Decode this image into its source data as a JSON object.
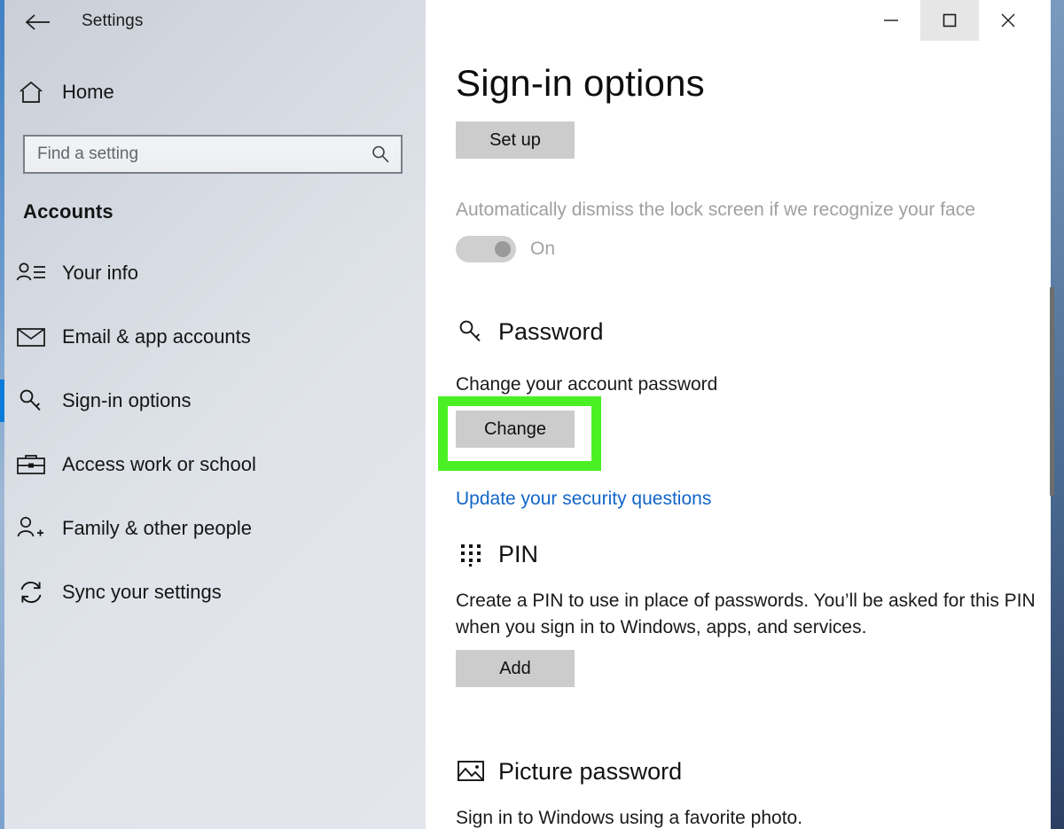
{
  "window": {
    "app_title": "Settings",
    "back_icon": "back-arrow-icon",
    "controls": {
      "minimize": "minimize-icon",
      "maximize": "maximize-icon",
      "close": "close-icon"
    }
  },
  "sidebar": {
    "home": {
      "label": "Home",
      "icon": "home-icon"
    },
    "search": {
      "placeholder": "Find a setting",
      "value": "",
      "icon": "search-icon"
    },
    "section_title": "Accounts",
    "items": [
      {
        "label": "Your info",
        "icon": "user-info-icon",
        "selected": false
      },
      {
        "label": "Email & app accounts",
        "icon": "envelope-icon",
        "selected": false
      },
      {
        "label": "Sign-in options",
        "icon": "key-icon",
        "selected": true
      },
      {
        "label": "Access work or school",
        "icon": "briefcase-icon",
        "selected": false
      },
      {
        "label": "Family & other people",
        "icon": "user-add-icon",
        "selected": false
      },
      {
        "label": "Sync your settings",
        "icon": "sync-icon",
        "selected": false
      }
    ]
  },
  "main": {
    "page_title": "Sign-in options",
    "windows_hello": {
      "setup_button": "Set up",
      "description": "Automatically dismiss the lock screen if we recognize your face",
      "toggle_state": "On",
      "toggle_on": true
    },
    "password": {
      "heading": "Password",
      "icon": "key-icon",
      "description": "Change your account password",
      "change_button": "Change",
      "security_questions_link": "Update your security questions"
    },
    "pin": {
      "heading": "PIN",
      "icon": "keypad-dots-icon",
      "description": "Create a PIN to use in place of passwords. You’ll be asked for this PIN when you sign in to Windows, apps, and services.",
      "add_button": "Add"
    },
    "picture_password": {
      "heading": "Picture password",
      "icon": "picture-icon",
      "description": "Sign in to Windows using a favorite photo."
    }
  },
  "annotations": {
    "highlight_color": "#4bf024",
    "highlight_target": "Change"
  },
  "colors": {
    "accent_blue": "#0a7bd8",
    "link_blue": "#1266c9",
    "button_gray": "#cccccc",
    "sidebar_bg": "#dfe3ea",
    "highlight_green": "#4bf024"
  }
}
